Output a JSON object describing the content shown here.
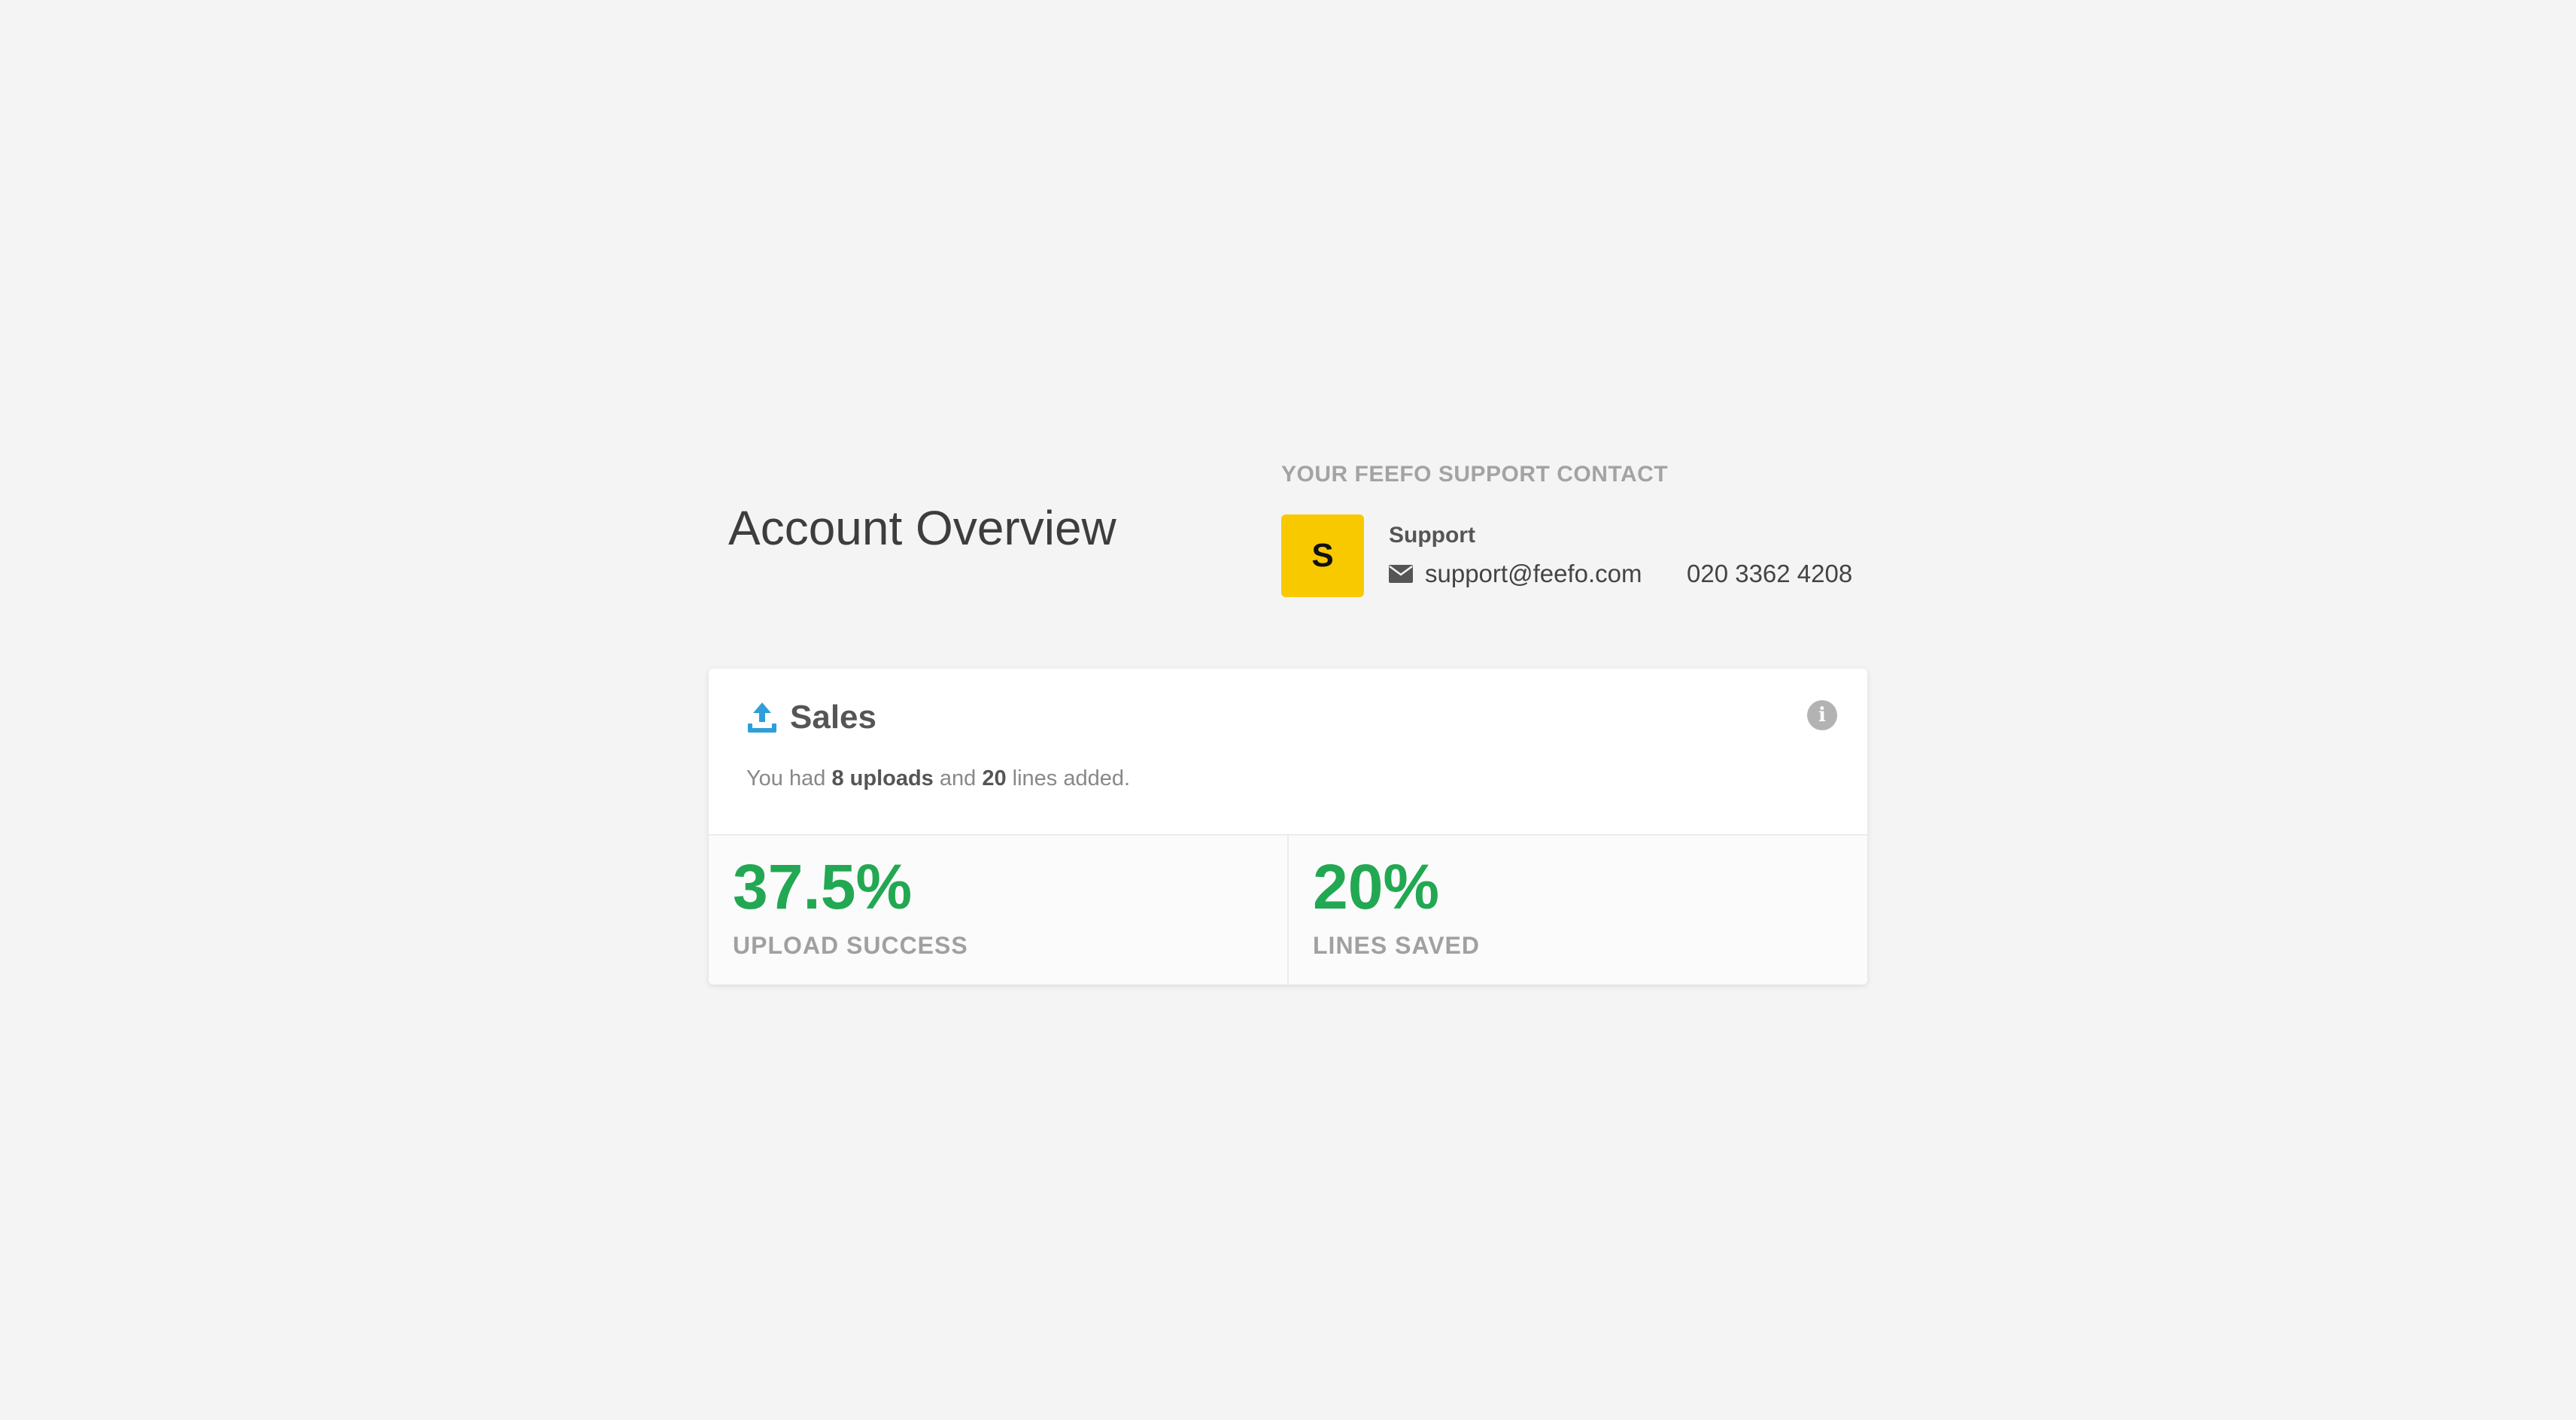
{
  "page": {
    "title": "Account Overview"
  },
  "support_contact": {
    "heading": "YOUR FEEFO SUPPORT CONTACT",
    "avatar_letter": "S",
    "avatar_color": "#f9c900",
    "name": "Support",
    "email": "support@feefo.com",
    "phone": "020 3362 4208",
    "email_icon": "envelope-icon"
  },
  "sales_card": {
    "icon": "upload-icon",
    "icon_color": "#2e9fd9",
    "title": "Sales",
    "summary": {
      "prefix": "You had",
      "uploads": "8 uploads",
      "middle": "and",
      "lines": "20",
      "suffix": "lines added."
    },
    "info_icon": "info-icon",
    "stats": [
      {
        "value": "37.5%",
        "label": "UPLOAD SUCCESS"
      },
      {
        "value": "20%",
        "label": "LINES SAVED"
      }
    ],
    "accent_color": "#22a852"
  }
}
